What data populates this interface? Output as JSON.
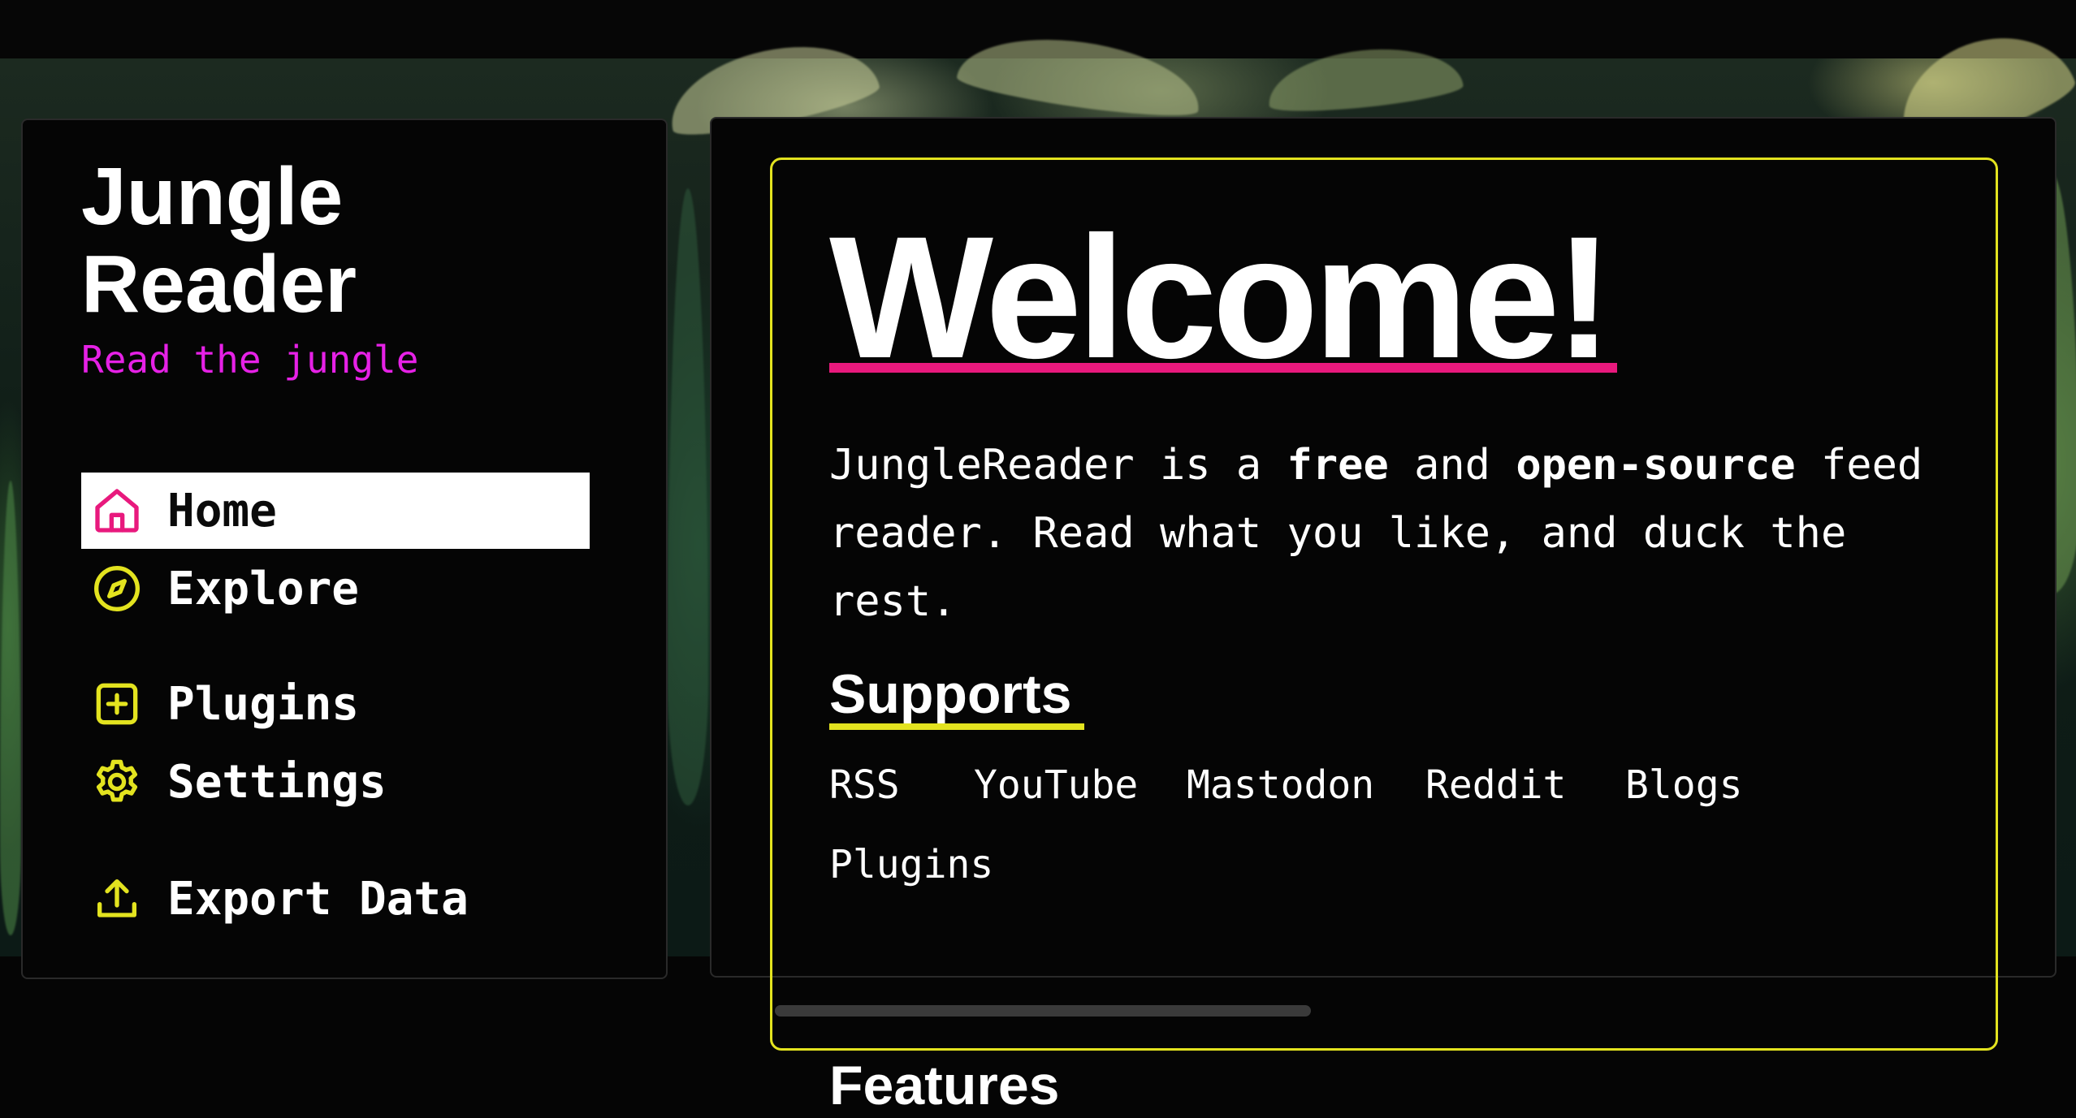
{
  "brand": {
    "title": "Jungle Reader",
    "tagline": "Read the jungle"
  },
  "nav": {
    "home": "Home",
    "explore": "Explore",
    "plugins": "Plugins",
    "settings": "Settings",
    "export": "Export Data"
  },
  "welcome": {
    "title": "Welcome!",
    "intro_1": "JungleReader is a ",
    "intro_free": "free",
    "intro_2": " and ",
    "intro_open": "open-source",
    "intro_3": " feed reader. Read what you like, and duck the rest."
  },
  "supports": {
    "heading": "Supports",
    "items": [
      "RSS",
      "YouTube",
      "Mastodon",
      "Reddit",
      "Blogs",
      "Plugins"
    ]
  },
  "features": {
    "heading": "Features"
  },
  "colors": {
    "accent_pink": "#e8197d",
    "accent_magenta": "#e621e6",
    "accent_yellow": "#e3e31f",
    "panel_bg": "#050505"
  },
  "icons": {
    "home": "home-icon",
    "explore": "compass-icon",
    "plugins": "plus-square-icon",
    "settings": "gear-icon",
    "export": "upload-icon"
  }
}
